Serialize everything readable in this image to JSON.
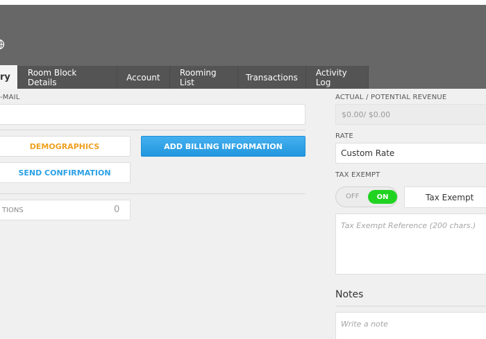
{
  "header": {
    "globe_icon": "globe-icon"
  },
  "tabs": [
    {
      "label": "ry",
      "active": true
    },
    {
      "label": "Room Block Details"
    },
    {
      "label": "Account"
    },
    {
      "label": "Rooming List"
    },
    {
      "label": "Transactions"
    },
    {
      "label": "Activity Log"
    }
  ],
  "left": {
    "email_label": "-MAIL",
    "email_value": "",
    "demographics_label": "DEMOGRAPHICS",
    "billing_label": "ADD BILLING INFORMATION",
    "send_confirmation_label": "SEND CONFIRMATION",
    "notifications_label": "TIONS",
    "notifications_count": "0"
  },
  "right": {
    "revenue_label": "ACTUAL / POTENTIAL REVENUE",
    "revenue_value": "$0.00/ $0.00",
    "rate_label": "RATE",
    "rate_value": "Custom Rate",
    "tax_exempt_label": "TAX EXEMPT",
    "toggle_off": "OFF",
    "toggle_on": "ON",
    "toggle_state": "on",
    "tax_exempt_button": "Tax Exempt",
    "tax_ref_placeholder": "Tax Exempt Reference (200 chars.)",
    "notes_title": "Notes",
    "note_placeholder": "Write a note"
  },
  "colors": {
    "header": "#676767",
    "tab_bg": "#545454",
    "accent_orange": "#f0a020",
    "accent_blue": "#2aa0e6",
    "toggle_green": "#21d321"
  }
}
